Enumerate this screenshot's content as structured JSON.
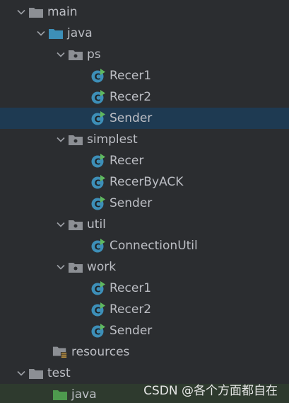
{
  "tree": {
    "main": "main",
    "java": "java",
    "ps": {
      "label": "ps",
      "items": [
        "Recer1",
        "Recer2",
        "Sender"
      ]
    },
    "simplest": {
      "label": "simplest",
      "items": [
        "Recer",
        "RecerByACK",
        "Sender"
      ]
    },
    "util": {
      "label": "util",
      "items": [
        "ConnectionUtil"
      ]
    },
    "work": {
      "label": "work",
      "items": [
        "Recer1",
        "Recer2",
        "Sender"
      ]
    },
    "resources": "resources",
    "test": "test",
    "test_java": "java"
  },
  "selected_item": "ps/Sender",
  "watermark": "CSDN @各个方面都自在",
  "colors": {
    "background": "#2b2d30",
    "selection": "#1e3a52",
    "folder_grey": "#8c8f94",
    "folder_blue": "#3d8fb8",
    "folder_green": "#4e9a4e",
    "class_icon": "#3d8fb8",
    "run_badge": "#5fb85f"
  }
}
